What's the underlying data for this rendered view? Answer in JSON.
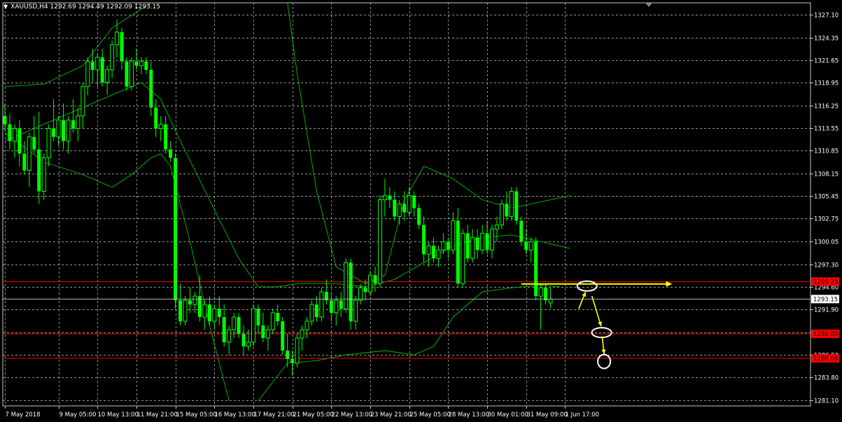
{
  "header": {
    "symbol": "XAUUSD,H4",
    "ohlc": "1292.69 1294.49 1292.09 1293.15"
  },
  "colors": {
    "background": "#000000",
    "grid": "#c8c8c8",
    "bull": "#00ff00",
    "bear": "#00ff00",
    "bands": "#00c000",
    "level": "#ff0000",
    "annotation": "#ffff00",
    "axis_text": "#ffffff"
  },
  "chart_data": {
    "type": "candlestick",
    "ylim": [
      1280.4,
      1328.5
    ],
    "grid": true,
    "price_ticks": [
      "1327.10",
      "1324.35",
      "1321.65",
      "1318.95",
      "1316.25",
      "1313.55",
      "1310.85",
      "1308.15",
      "1305.45",
      "1302.75",
      "1300.05",
      "1297.30",
      "1294.60",
      "1291.90",
      "1289.20",
      "1286.50",
      "1283.80",
      "1281.10"
    ],
    "time_labels": [
      {
        "label": "7 May 2018",
        "bar": 0
      },
      {
        "label": "9 May 05:00",
        "bar": 11
      },
      {
        "label": "10 May 13:00",
        "bar": 19
      },
      {
        "label": "11 May 21:00",
        "bar": 27
      },
      {
        "label": "15 May 05:00",
        "bar": 35
      },
      {
        "label": "16 May 13:00",
        "bar": 43
      },
      {
        "label": "17 May 21:00",
        "bar": 51
      },
      {
        "label": "21 May 05:00",
        "bar": 59
      },
      {
        "label": "22 May 13:00",
        "bar": 67
      },
      {
        "label": "23 May 21:00",
        "bar": 75
      },
      {
        "label": "25 May 05:00",
        "bar": 83
      },
      {
        "label": "28 May 13:00",
        "bar": 91
      },
      {
        "label": "30 May 01:00",
        "bar": 99
      },
      {
        "label": "31 May 09:00",
        "bar": 107
      },
      {
        "label": "1 Jun 17:00",
        "bar": 115
      }
    ],
    "candles": [
      [
        1315.0,
        1316.5,
        1313.2,
        1314.0
      ],
      [
        1314.0,
        1315.2,
        1311.0,
        1312.0
      ],
      [
        1312.0,
        1314.0,
        1310.0,
        1313.5
      ],
      [
        1313.5,
        1314.5,
        1309.0,
        1310.5
      ],
      [
        1310.5,
        1312.0,
        1308.0,
        1308.5
      ],
      [
        1308.5,
        1313.0,
        1306.5,
        1312.5
      ],
      [
        1312.5,
        1315.0,
        1310.5,
        1311.0
      ],
      [
        1311.0,
        1315.5,
        1304.5,
        1306.0
      ],
      [
        1306.0,
        1310.5,
        1305.0,
        1310.0
      ],
      [
        1310.0,
        1314.0,
        1309.0,
        1313.5
      ],
      [
        1313.5,
        1317.0,
        1312.0,
        1312.5
      ],
      [
        1312.5,
        1315.0,
        1311.5,
        1314.5
      ],
      [
        1314.5,
        1316.5,
        1311.0,
        1312.0
      ],
      [
        1312.0,
        1315.0,
        1310.5,
        1314.5
      ],
      [
        1314.5,
        1317.0,
        1313.0,
        1313.5
      ],
      [
        1313.5,
        1316.0,
        1312.0,
        1315.0
      ],
      [
        1315.0,
        1319.0,
        1313.5,
        1318.5
      ],
      [
        1318.5,
        1322.0,
        1317.5,
        1321.5
      ],
      [
        1321.5,
        1323.0,
        1319.0,
        1320.5
      ],
      [
        1320.5,
        1322.5,
        1318.5,
        1322.0
      ],
      [
        1322.0,
        1323.0,
        1318.5,
        1319.0
      ],
      [
        1319.0,
        1321.0,
        1317.5,
        1320.5
      ],
      [
        1320.5,
        1324.0,
        1319.5,
        1323.5
      ],
      [
        1323.5,
        1326.5,
        1322.0,
        1325.0
      ],
      [
        1325.0,
        1325.5,
        1320.5,
        1321.5
      ],
      [
        1321.5,
        1322.0,
        1318.0,
        1318.5
      ],
      [
        1318.5,
        1322.0,
        1318.0,
        1321.5
      ],
      [
        1321.5,
        1323.0,
        1320.5,
        1321.0
      ],
      [
        1321.0,
        1322.0,
        1320.0,
        1321.5
      ],
      [
        1321.5,
        1322.0,
        1320.0,
        1320.5
      ],
      [
        1320.5,
        1321.5,
        1315.0,
        1316.0
      ],
      [
        1316.0,
        1317.0,
        1312.5,
        1313.5
      ],
      [
        1313.5,
        1315.0,
        1312.0,
        1314.0
      ],
      [
        1314.0,
        1315.0,
        1310.5,
        1311.0
      ],
      [
        1311.0,
        1312.0,
        1309.5,
        1310.0
      ],
      [
        1310.0,
        1310.5,
        1292.0,
        1293.0
      ],
      [
        1293.0,
        1295.0,
        1290.0,
        1290.5
      ],
      [
        1290.5,
        1293.5,
        1290.0,
        1293.0
      ],
      [
        1293.0,
        1294.5,
        1291.5,
        1292.5
      ],
      [
        1292.5,
        1294.0,
        1291.5,
        1293.5
      ],
      [
        1293.5,
        1296.0,
        1290.5,
        1291.0
      ],
      [
        1291.0,
        1293.0,
        1289.5,
        1292.5
      ],
      [
        1292.5,
        1293.5,
        1290.0,
        1290.5
      ],
      [
        1290.5,
        1292.5,
        1289.5,
        1292.0
      ],
      [
        1292.0,
        1293.5,
        1290.0,
        1291.0
      ],
      [
        1291.0,
        1292.5,
        1287.5,
        1288.0
      ],
      [
        1288.0,
        1290.0,
        1286.5,
        1289.5
      ],
      [
        1289.5,
        1291.5,
        1288.5,
        1291.0
      ],
      [
        1291.0,
        1291.5,
        1288.5,
        1289.0
      ],
      [
        1289.0,
        1290.0,
        1286.5,
        1287.5
      ],
      [
        1287.5,
        1289.5,
        1287.0,
        1288.0
      ],
      [
        1288.0,
        1292.5,
        1287.5,
        1292.0
      ],
      [
        1292.0,
        1292.5,
        1289.0,
        1290.0
      ],
      [
        1290.0,
        1291.5,
        1288.0,
        1288.5
      ],
      [
        1288.5,
        1290.0,
        1287.0,
        1289.5
      ],
      [
        1289.5,
        1292.0,
        1289.0,
        1291.5
      ],
      [
        1291.5,
        1292.5,
        1290.0,
        1290.5
      ],
      [
        1290.5,
        1291.0,
        1286.5,
        1287.0
      ],
      [
        1287.0,
        1289.0,
        1285.0,
        1286.0
      ],
      [
        1286.0,
        1287.0,
        1284.0,
        1285.5
      ],
      [
        1285.5,
        1289.0,
        1285.0,
        1288.5
      ],
      [
        1288.5,
        1290.0,
        1287.0,
        1289.5
      ],
      [
        1289.5,
        1291.0,
        1288.5,
        1290.5
      ],
      [
        1290.5,
        1293.0,
        1290.0,
        1292.5
      ],
      [
        1292.5,
        1293.5,
        1290.5,
        1291.0
      ],
      [
        1291.0,
        1294.5,
        1290.5,
        1294.0
      ],
      [
        1294.0,
        1295.5,
        1292.5,
        1293.0
      ],
      [
        1293.0,
        1294.0,
        1290.5,
        1291.5
      ],
      [
        1291.5,
        1293.5,
        1290.0,
        1293.0
      ],
      [
        1293.0,
        1294.0,
        1291.0,
        1292.0
      ],
      [
        1292.0,
        1298.0,
        1291.5,
        1297.5
      ],
      [
        1297.5,
        1298.0,
        1289.5,
        1290.5
      ],
      [
        1290.5,
        1293.5,
        1289.5,
        1293.0
      ],
      [
        1293.0,
        1295.0,
        1292.5,
        1294.5
      ],
      [
        1294.5,
        1295.5,
        1293.0,
        1294.0
      ],
      [
        1294.0,
        1296.5,
        1293.5,
        1296.0
      ],
      [
        1296.0,
        1297.0,
        1294.0,
        1295.0
      ],
      [
        1295.0,
        1305.5,
        1294.5,
        1305.0
      ],
      [
        1305.0,
        1307.5,
        1303.0,
        1305.5
      ],
      [
        1305.5,
        1306.5,
        1304.0,
        1305.0
      ],
      [
        1305.0,
        1306.0,
        1302.5,
        1303.0
      ],
      [
        1303.0,
        1305.0,
        1302.0,
        1304.5
      ],
      [
        1304.5,
        1306.0,
        1302.5,
        1303.5
      ],
      [
        1303.5,
        1306.5,
        1303.0,
        1305.5
      ],
      [
        1305.5,
        1306.0,
        1303.0,
        1304.0
      ],
      [
        1304.0,
        1304.5,
        1301.5,
        1302.0
      ],
      [
        1302.0,
        1303.0,
        1297.5,
        1298.5
      ],
      [
        1298.5,
        1300.0,
        1297.0,
        1299.5
      ],
      [
        1299.5,
        1300.5,
        1297.5,
        1298.0
      ],
      [
        1298.0,
        1299.5,
        1297.0,
        1299.0
      ],
      [
        1299.0,
        1301.0,
        1298.5,
        1300.0
      ],
      [
        1300.0,
        1300.5,
        1298.0,
        1299.0
      ],
      [
        1299.0,
        1303.5,
        1298.5,
        1302.5
      ],
      [
        1302.5,
        1304.0,
        1294.5,
        1295.0
      ],
      [
        1295.0,
        1301.5,
        1294.5,
        1301.0
      ],
      [
        1301.0,
        1302.0,
        1297.5,
        1298.0
      ],
      [
        1298.0,
        1301.5,
        1297.5,
        1300.5
      ],
      [
        1300.5,
        1301.5,
        1298.0,
        1299.0
      ],
      [
        1299.0,
        1302.0,
        1298.5,
        1301.0
      ],
      [
        1301.0,
        1302.5,
        1298.5,
        1299.0
      ],
      [
        1299.0,
        1302.0,
        1298.0,
        1301.5
      ],
      [
        1301.5,
        1303.0,
        1300.0,
        1302.0
      ],
      [
        1302.0,
        1305.0,
        1301.5,
        1304.5
      ],
      [
        1304.5,
        1306.0,
        1302.5,
        1303.0
      ],
      [
        1303.0,
        1306.5,
        1302.5,
        1306.0
      ],
      [
        1306.0,
        1306.5,
        1302.0,
        1302.5
      ],
      [
        1302.5,
        1303.0,
        1299.5,
        1300.0
      ],
      [
        1300.0,
        1301.5,
        1298.5,
        1299.0
      ],
      [
        1299.0,
        1300.5,
        1297.5,
        1300.0
      ],
      [
        1300.0,
        1300.5,
        1293.0,
        1293.5
      ],
      [
        1293.5,
        1295.0,
        1289.5,
        1294.5
      ],
      [
        1294.5,
        1295.0,
        1292.5,
        1293.0
      ],
      [
        1292.69,
        1294.49,
        1292.09,
        1293.15
      ]
    ],
    "bands": {
      "middle": [
        [
          0,
          1312.0
        ],
        [
          8,
          1314.0
        ],
        [
          16,
          1316.0
        ],
        [
          24,
          1318.0
        ],
        [
          28,
          1319.0
        ],
        [
          32,
          1317.0
        ],
        [
          36,
          1312.0
        ],
        [
          42,
          1305.0
        ],
        [
          48,
          1298.0
        ],
        [
          52,
          1294.6
        ],
        [
          56,
          1294.6
        ],
        [
          60,
          1295.0
        ],
        [
          68,
          1295.0
        ],
        [
          74,
          1294.6
        ],
        [
          80,
          1295.5
        ],
        [
          86,
          1297.5
        ],
        [
          92,
          1299.5
        ],
        [
          98,
          1300.5
        ],
        [
          104,
          1300.8
        ],
        [
          110,
          1300.0
        ],
        [
          116,
          1299.2
        ]
      ],
      "upper": [
        [
          0,
          1318.5
        ],
        [
          8,
          1318.8
        ],
        [
          16,
          1321.0
        ],
        [
          22,
          1325.5
        ],
        [
          26,
          1327.0
        ],
        [
          30,
          1328.5
        ]
      ],
      "upper_b": [
        [
          58,
          1328.5
        ],
        [
          60,
          1320.0
        ],
        [
          64,
          1306.0
        ],
        [
          68,
          1297.0
        ],
        [
          74,
          1295.0
        ],
        [
          78,
          1296.0
        ],
        [
          82,
          1305.0
        ],
        [
          86,
          1309.0
        ],
        [
          92,
          1307.5
        ],
        [
          98,
          1305.0
        ],
        [
          104,
          1304.0
        ],
        [
          108,
          1304.5
        ],
        [
          112,
          1305.0
        ],
        [
          116,
          1305.5
        ]
      ],
      "lower": [
        [
          0,
          1313.0
        ],
        [
          8,
          1309.5
        ],
        [
          16,
          1308.0
        ],
        [
          22,
          1306.5
        ],
        [
          26,
          1308.0
        ],
        [
          30,
          1310.0
        ],
        [
          32,
          1310.5
        ],
        [
          34,
          1309.0
        ],
        [
          38,
          1300.0
        ],
        [
          42,
          1290.0
        ],
        [
          46,
          1281.0
        ]
      ],
      "lower_b": [
        [
          52,
          1281.0
        ],
        [
          58,
          1285.5
        ],
        [
          64,
          1285.8
        ],
        [
          70,
          1286.5
        ],
        [
          78,
          1287.0
        ],
        [
          84,
          1286.5
        ],
        [
          88,
          1287.5
        ],
        [
          92,
          1291.0
        ],
        [
          98,
          1294.0
        ],
        [
          104,
          1294.5
        ],
        [
          110,
          1294.8
        ],
        [
          114,
          1294.6
        ]
      ]
    },
    "levels": [
      {
        "price": 1295.23,
        "label": "1295.23"
      },
      {
        "price": 1289.0,
        "label": "1289.00"
      },
      {
        "price": 1286.08,
        "label": "1286.08"
      }
    ],
    "current": {
      "price": 1293.15,
      "label": "1293.15"
    },
    "annotations": {
      "hline": {
        "bar_from": 106,
        "bar_to": 137,
        "price": 1294.95
      },
      "ellipses": [
        {
          "bar": 119.5,
          "price": 1294.7
        },
        {
          "bar": 122.5,
          "price": 1289.15
        },
        {
          "bar": 123.0,
          "price": 1285.7
        }
      ],
      "arrows": [
        {
          "from": [
            117.8,
            1292.0
          ],
          "to": [
            119.2,
            1294.0
          ]
        },
        {
          "from": [
            120.5,
            1293.5
          ],
          "to": [
            122.4,
            1289.9
          ]
        },
        {
          "from": [
            122.6,
            1288.7
          ],
          "to": [
            123.0,
            1286.6
          ]
        }
      ]
    }
  }
}
